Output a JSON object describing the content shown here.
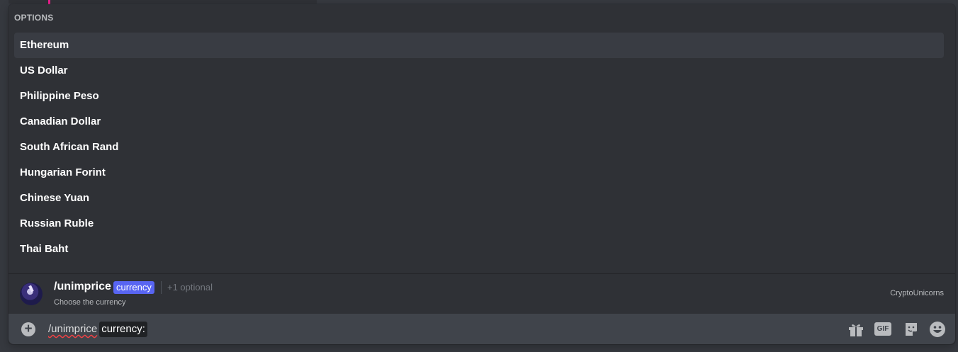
{
  "options": {
    "header": "OPTIONS",
    "items": [
      {
        "label": "Ethereum",
        "selected": true
      },
      {
        "label": "US Dollar",
        "selected": false
      },
      {
        "label": "Philippine Peso",
        "selected": false
      },
      {
        "label": "Canadian Dollar",
        "selected": false
      },
      {
        "label": "South African Rand",
        "selected": false
      },
      {
        "label": "Hungarian Forint",
        "selected": false
      },
      {
        "label": "Chinese Yuan",
        "selected": false
      },
      {
        "label": "Russian Ruble",
        "selected": false
      },
      {
        "label": "Thai Baht",
        "selected": false
      }
    ]
  },
  "command": {
    "name": "/unimprice",
    "param": "currency",
    "optional": "+1 optional",
    "description": "Choose the currency",
    "bot": "CryptoUnicorns"
  },
  "input": {
    "typed": "/unimprice",
    "chip": "currency:"
  },
  "toolbar": {
    "gif_label": "GIF",
    "icons": [
      "gift-icon",
      "gif-icon",
      "sticker-icon",
      "emoji-icon"
    ]
  },
  "colors": {
    "accent": "#5865f2",
    "selected_bg": "#393c43",
    "popup_bg": "#2f3136",
    "input_bg": "#40444b",
    "marker": "#e91e8c"
  }
}
